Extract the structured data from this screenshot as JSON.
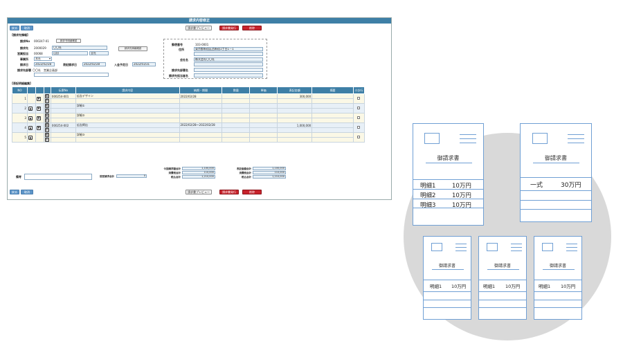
{
  "window": {
    "title": "請求内容修正"
  },
  "toolbar": {
    "back": "戻る",
    "cancel": "取消",
    "preview": "請求書プレビュー",
    "issue": "請求書発行",
    "delete": "削除"
  },
  "info": {
    "section": "【請求先情報】",
    "invoice_no_label": "請求No",
    "invoice_no": "000247-01",
    "invoice_no_btn": "請求书明细確認",
    "client_label": "請求先",
    "client_code": "2000029",
    "client_name": "〇〇社",
    "client_detail_btn": "請求先情報確認",
    "sales_label": "営業担当",
    "sales_code": "00068",
    "sales_name": "山田 ",
    "sales_dept": "全社",
    "office_label": "事業所",
    "office_value": "本社",
    "date_label": "請求日",
    "date_value": "2022/02/28",
    "record_label": "表記請求日",
    "record_value": "2022/02/28",
    "due_label": "入金予定日",
    "due_value": "2022/03/31",
    "dept_label": "請求先部署",
    "dept_value": "〇〇社　営業企画部"
  },
  "address": {
    "zip_label": "郵便番号",
    "zip": "103-0001",
    "addr_label": "住所",
    "addr": "東京都新宿区西新宿1丁目1－1",
    "company_label": "会社名",
    "company": "株式会社〇〇社",
    "dept_label": "請求先部署名",
    "dept": "",
    "person_label": "請求先担当者名",
    "person": ""
  },
  "detail": {
    "section": "【表記明細編集】",
    "headers": [
      "NO",
      "",
      "",
      "",
      "伝票No",
      "請求内容",
      "納期・期間",
      "数量",
      "単価",
      "表記金額",
      "摘要",
      "小計行"
    ],
    "rows": [
      {
        "no": "1",
        "slip": "000254-001",
        "content": "広告デザイン",
        "period": "2022/02/28",
        "qty": "",
        "price": "",
        "amount": "300,000",
        "note": ""
      },
      {
        "no": "2",
        "slip": "",
        "content": "詳細①",
        "period": "",
        "qty": "",
        "price": "",
        "amount": "",
        "note": ""
      },
      {
        "no": "3",
        "slip": "",
        "content": "詳細②",
        "period": "",
        "qty": "",
        "price": "",
        "amount": "",
        "note": ""
      },
      {
        "no": "4",
        "slip": "000254-002",
        "content": "広告掲出",
        "period": "2022/02/28～2022/02/28",
        "qty": "",
        "price": "",
        "amount": "1,000,000",
        "note": ""
      },
      {
        "no": "5",
        "slip": "",
        "content": "詳細③",
        "period": "",
        "qty": "",
        "price": "",
        "amount": "",
        "note": ""
      }
    ],
    "edit_label": "編",
    "del_label": "削"
  },
  "summary": {
    "remarks_label": "備考",
    "prev_label": "前受請求合計",
    "prev_value": "0",
    "cur_total_label": "今回請求額合計",
    "cur_total": "1,100,000",
    "cur_tax_label": "消費税合計",
    "cur_tax": "110,000",
    "cur_incl_label": "税込合計",
    "cur_incl": "1,210,000",
    "rec_total_label": "表記金額合計",
    "rec_total": "1,100,000",
    "rec_tax_label": "消費税合計",
    "rec_tax": "110,000",
    "rec_incl_label": "税込合計",
    "rec_incl": "1,210,000"
  },
  "illustration": {
    "doc_title": "御請求書",
    "big1": {
      "rows": [
        {
          "item": "明細1",
          "amount": "10万円"
        },
        {
          "item": "明細2",
          "amount": "10万円"
        },
        {
          "item": "明細3",
          "amount": "10万円"
        }
      ]
    },
    "big2": {
      "rows": [
        {
          "item": "一式",
          "amount": "30万円"
        }
      ]
    },
    "small": [
      {
        "item": "明細1",
        "amount": "10万円"
      },
      {
        "item": "明細1",
        "amount": "10万円"
      },
      {
        "item": "明細1",
        "amount": "10万円"
      }
    ]
  },
  "colors": {
    "header": "#3e7fa6",
    "accent_red": "#c8232c",
    "doc_line": "#6f9fd4",
    "circle": "#d9d9d9"
  }
}
